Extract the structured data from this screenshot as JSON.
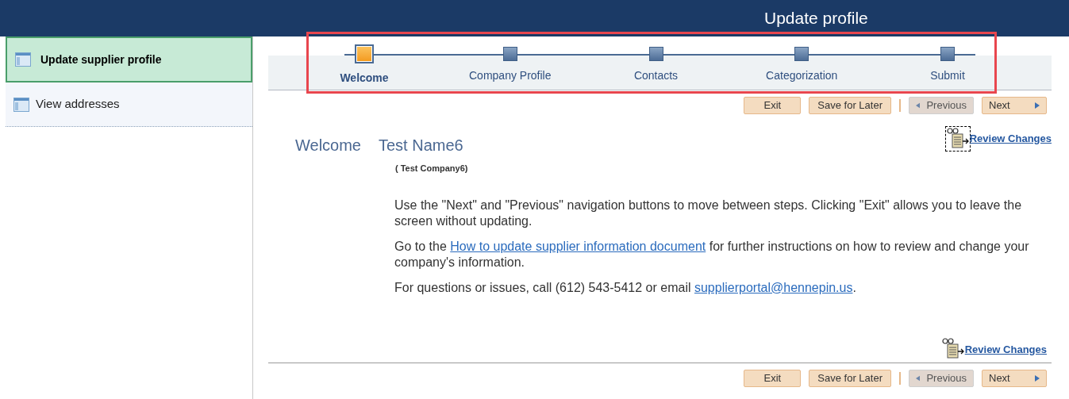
{
  "header": {
    "title": "Update profile"
  },
  "sidebar": {
    "items": [
      {
        "label": "Update supplier profile",
        "selected": true
      },
      {
        "label": "View addresses",
        "selected": false
      }
    ]
  },
  "steps": [
    {
      "label": "Welcome",
      "selected": true
    },
    {
      "label": "Company Profile",
      "selected": false
    },
    {
      "label": "Contacts",
      "selected": false
    },
    {
      "label": "Categorization",
      "selected": false
    },
    {
      "label": "Submit",
      "selected": false
    }
  ],
  "top_buttons": [
    {
      "label": "Exit",
      "kind": "plain",
      "disabled": false
    },
    {
      "label": "Save for Later",
      "kind": "plain",
      "disabled": false
    },
    {
      "label": "Previous",
      "kind": "previous",
      "disabled": true
    },
    {
      "label": "Next",
      "kind": "next",
      "disabled": false
    }
  ],
  "welcome": {
    "greeting": "Welcome",
    "name": "Test Name6",
    "company": "( Test Company6)",
    "review_link": "Review Changes"
  },
  "paragraphs": [
    {
      "parts": [
        {
          "text": "Use the \"Next\" and \"Previous\" navigation buttons to move between steps. Clicking \"Exit\" allows you to leave the screen without updating.",
          "kind": "text"
        }
      ]
    },
    {
      "parts": [
        {
          "text": "Go to the ",
          "kind": "text"
        },
        {
          "text": "How to update supplier information document",
          "kind": "link"
        },
        {
          "text": " for further instructions on how to review and change your company's information.",
          "kind": "text"
        }
      ]
    },
    {
      "parts": [
        {
          "text": "For questions or issues, call (612) 543-5412 or email ",
          "kind": "text"
        },
        {
          "text": "supplierportal@hennepin.us",
          "kind": "link"
        },
        {
          "text": ".",
          "kind": "text"
        }
      ]
    }
  ],
  "bottom_review_link": "Review Changes",
  "bottom_buttons": [
    {
      "label": "Exit",
      "kind": "plain",
      "disabled": false
    },
    {
      "label": "Save for Later",
      "kind": "plain",
      "disabled": false
    },
    {
      "label": "Previous",
      "kind": "previous",
      "disabled": true
    },
    {
      "label": "Next",
      "kind": "next",
      "disabled": false
    }
  ]
}
